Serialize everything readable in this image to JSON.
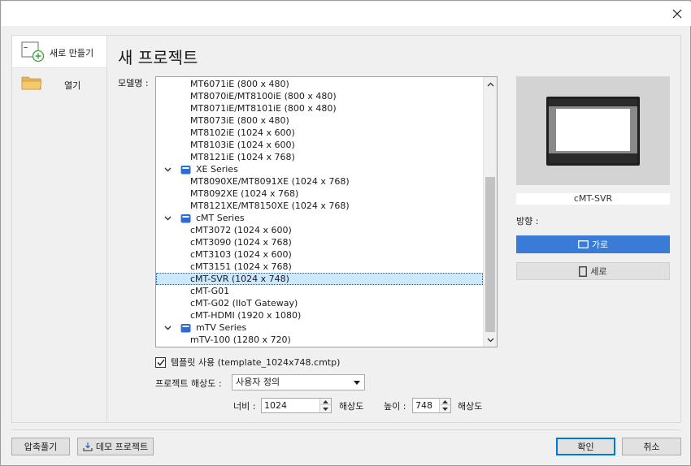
{
  "window": {
    "close_icon": "close-icon"
  },
  "sidebar": {
    "items": [
      {
        "label": "새로 만들기",
        "icon": "new-document-icon"
      },
      {
        "label": "열기",
        "icon": "folder-icon"
      }
    ]
  },
  "main": {
    "title": "새 프로젝트",
    "model_label": "모델명 :",
    "models": [
      {
        "type": "model",
        "text": "MT6071iE (800 x 480)"
      },
      {
        "type": "model",
        "text": "MT8070iE/MT8100iE (800 x 480)"
      },
      {
        "type": "model",
        "text": "MT8071iE/MT8101iE (800 x 480)"
      },
      {
        "type": "model",
        "text": "MT8073iE (800 x 480)"
      },
      {
        "type": "model",
        "text": "MT8102iE (1024 x 600)"
      },
      {
        "type": "model",
        "text": "MT8103iE (1024 x 600)"
      },
      {
        "type": "model",
        "text": "MT8121iE (1024 x 768)"
      },
      {
        "type": "group",
        "text": "XE Series"
      },
      {
        "type": "model",
        "text": "MT8090XE/MT8091XE (1024 x 768)"
      },
      {
        "type": "model",
        "text": "MT8092XE (1024 x 768)"
      },
      {
        "type": "model",
        "text": "MT8121XE/MT8150XE (1024 x 768)"
      },
      {
        "type": "group",
        "text": "cMT Series"
      },
      {
        "type": "model",
        "text": "cMT3072 (1024 x 600)"
      },
      {
        "type": "model",
        "text": "cMT3090 (1024 x 768)"
      },
      {
        "type": "model",
        "text": "cMT3103 (1024 x 600)"
      },
      {
        "type": "model",
        "text": "cMT3151 (1024 x 768)"
      },
      {
        "type": "model",
        "text": "cMT-SVR (1024 x 748)",
        "selected": true
      },
      {
        "type": "model",
        "text": "cMT-G01"
      },
      {
        "type": "model",
        "text": "cMT-G02 (IIoT Gateway)"
      },
      {
        "type": "model",
        "text": "cMT-HDMI (1920 x 1080)"
      },
      {
        "type": "group",
        "text": "mTV Series"
      },
      {
        "type": "model",
        "text": "mTV-100 (1280 x 720)"
      }
    ],
    "preview_name": "cMT-SVR",
    "orientation_label": "방향 :",
    "landscape_label": "가로",
    "portrait_label": "세로",
    "template_checkbox_label": "템플릿 사용 (template_1024x748.cmtp)",
    "template_checked": true,
    "resolution_label": "프로젝트 해상도 :",
    "resolution_value": "사용자 정의",
    "width_label": "너비 :",
    "width_value": "1024",
    "width_unit": "해상도",
    "height_label": "높이 :",
    "height_value": "748",
    "height_unit": "해상도"
  },
  "footer": {
    "decompress_label": "압축풀기",
    "demo_label": "데모 프로젝트",
    "ok_label": "확인",
    "cancel_label": "취소"
  },
  "colors": {
    "accent": "#3a7bd5",
    "selection": "#cce8ff",
    "group_icon": "#2a6dd6"
  }
}
